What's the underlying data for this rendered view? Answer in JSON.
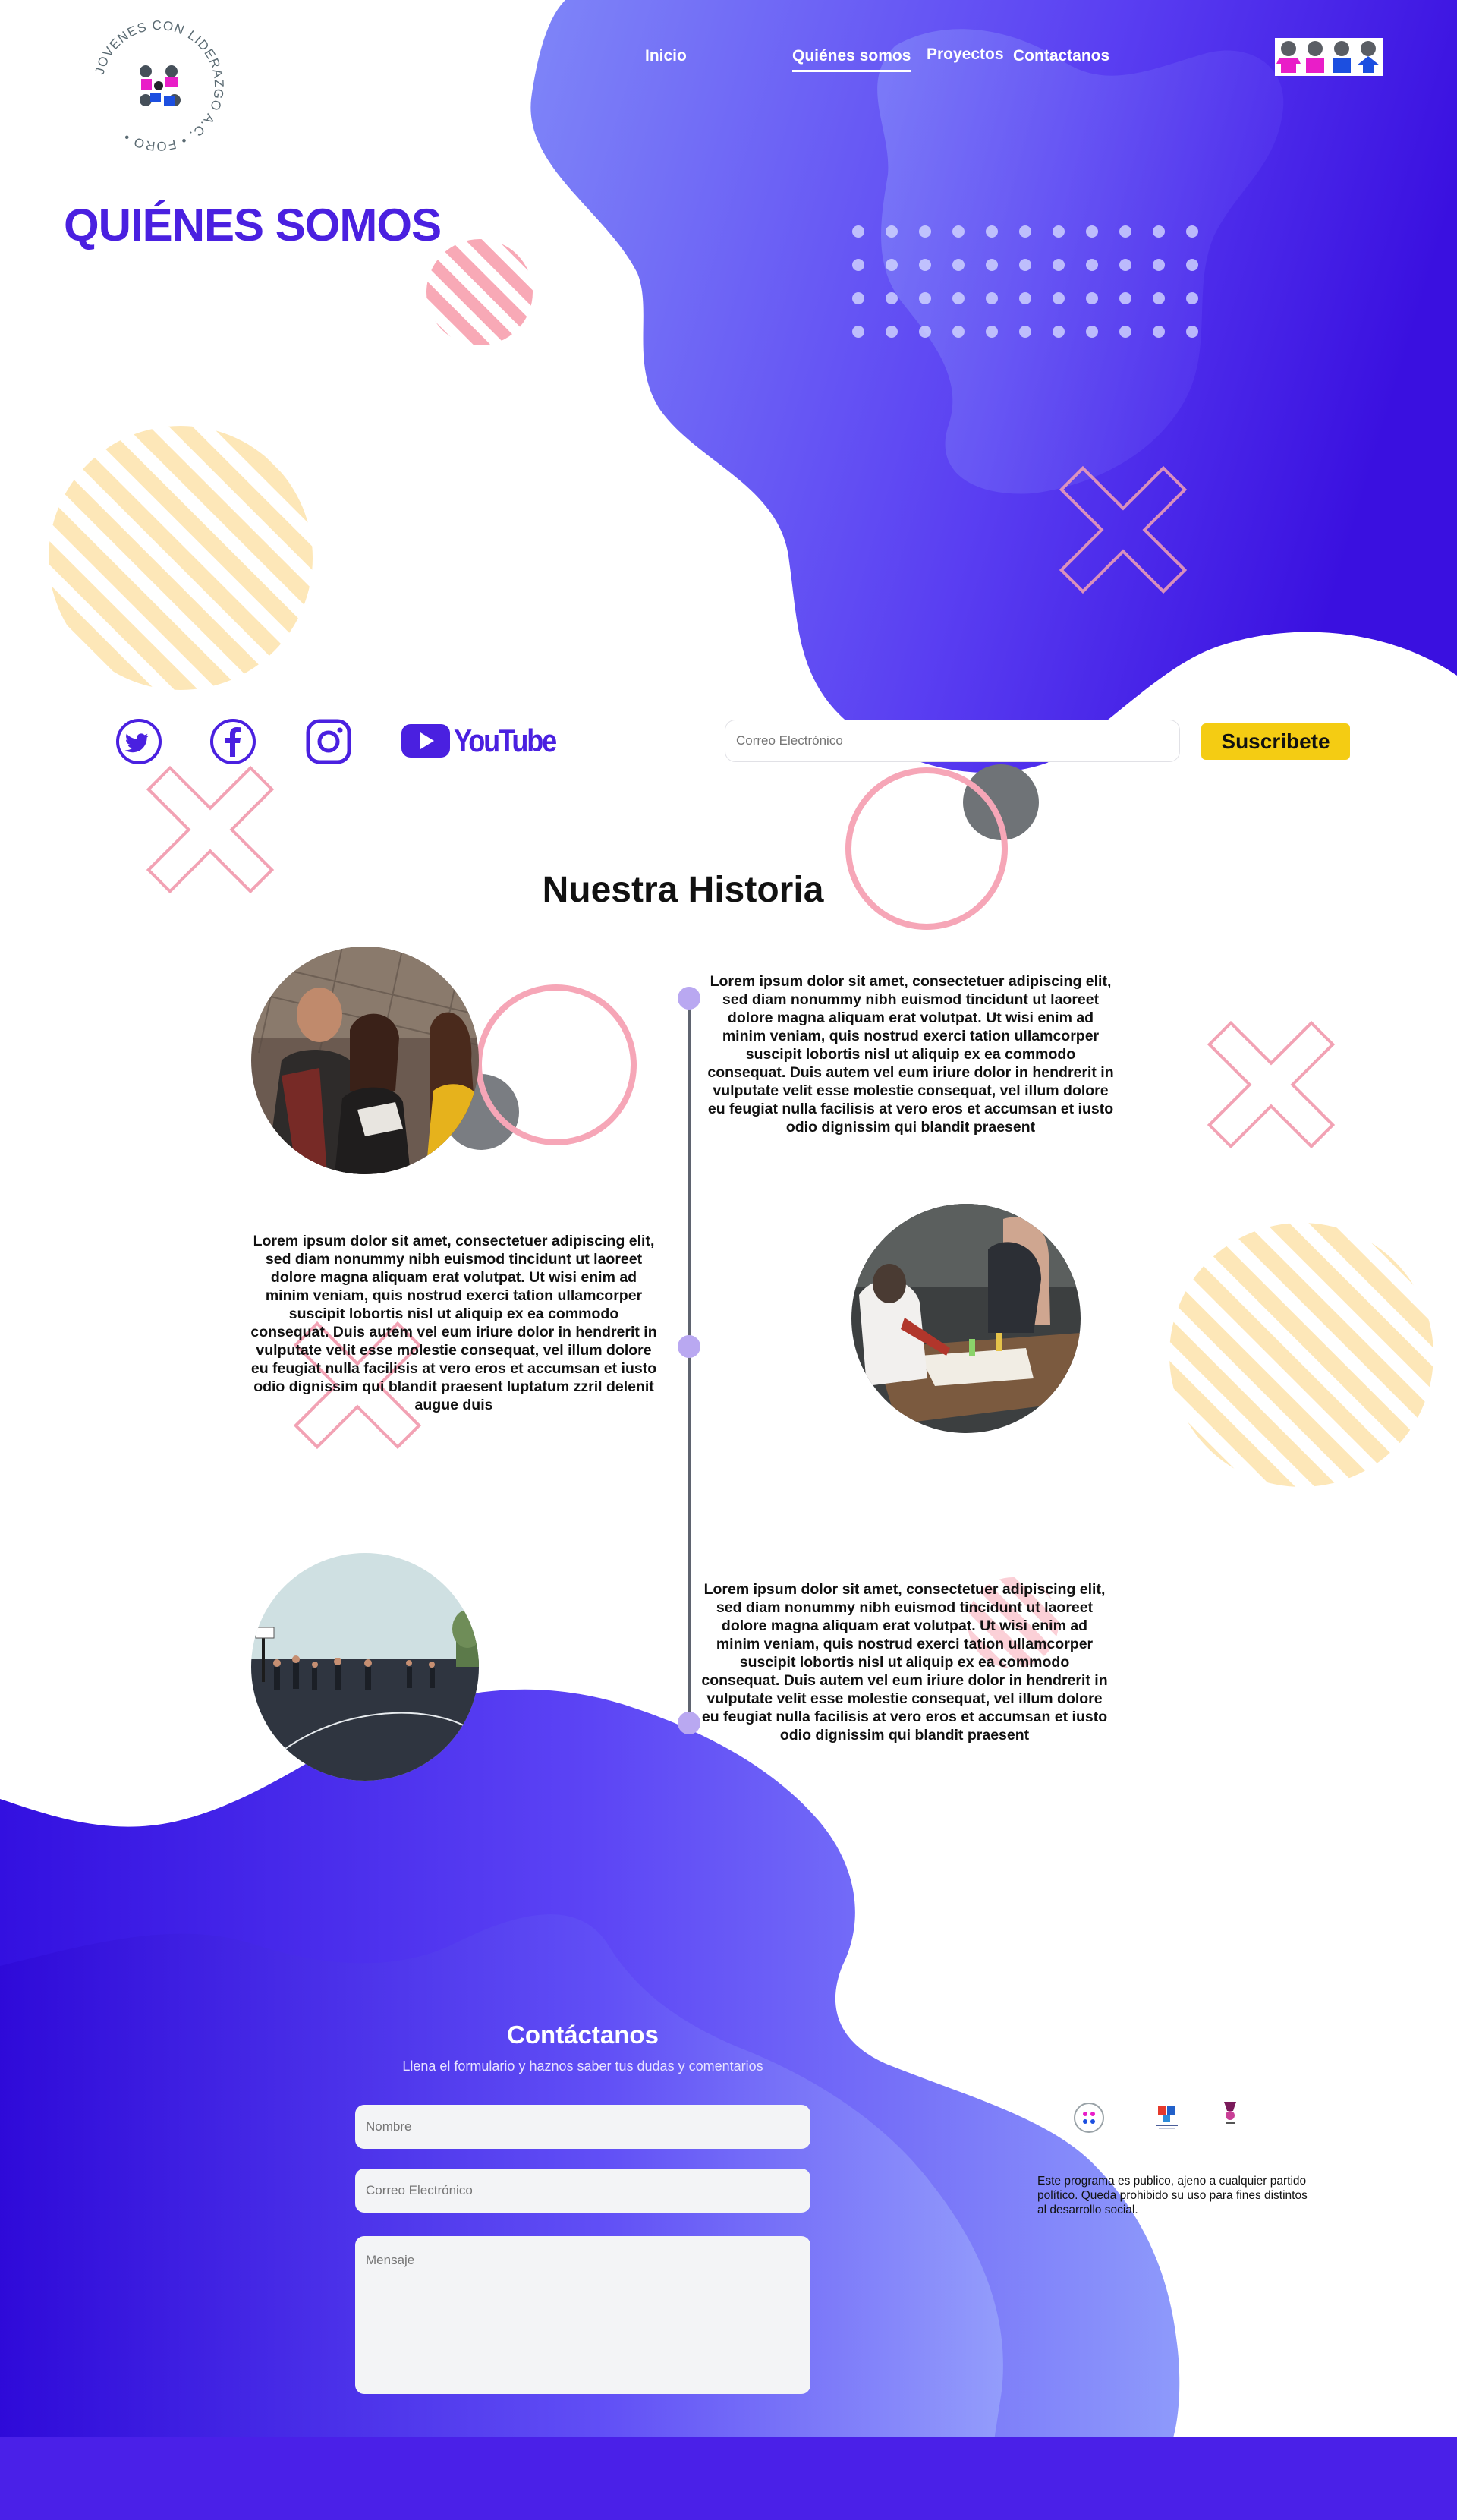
{
  "brand": {
    "logo_text": "JOVENES CON LIDERAZGO A.C. • FORO •",
    "colors": {
      "primary": "#4a20e0",
      "accent_yellow": "#f4cc13",
      "pink": "#f7a5b4",
      "stripe_yellow": "#fde7b8"
    }
  },
  "nav": {
    "items": [
      {
        "label": "Inicio"
      },
      {
        "label": "Quiénes somos",
        "active": true
      },
      {
        "label": "Proyectos"
      },
      {
        "label": "Contactanos"
      }
    ],
    "right_logo_icon": "people-group-icon"
  },
  "hero": {
    "title": "QUIÉNES SOMOS"
  },
  "social": {
    "icons": [
      "twitter-icon",
      "facebook-icon",
      "instagram-icon",
      "youtube-icon"
    ],
    "youtube_label": "YouTube"
  },
  "newsletter": {
    "placeholder": "Correo Electrónico",
    "button_label": "Suscribete"
  },
  "history": {
    "title": "Nuestra Historia",
    "entries": [
      {
        "text": "Lorem ipsum dolor sit amet, consectetuer adipiscing elit, sed diam nonummy nibh euismod tincidunt ut laoreet dolore magna aliquam erat volutpat. Ut wisi enim ad minim veniam, quis nostrud exerci tation ullamcorper suscipit lobortis nisl ut aliquip ex ea commodo consequat. Duis autem vel eum iriure dolor in hendrerit in vulputate velit esse molestie consequat, vel illum dolore eu feugiat nulla facilisis at vero eros et accumsan et iusto odio dignissim qui blandit praesent",
        "photo": "students-talking-photo"
      },
      {
        "text": "Lorem ipsum dolor sit amet, consectetuer adipiscing elit, sed diam nonummy nibh euismod tincidunt ut laoreet dolore magna aliquam erat volutpat. Ut wisi enim ad minim veniam, quis nostrud exerci tation ullamcorper suscipit lobortis nisl ut aliquip ex ea commodo consequat. Duis autem vel eum iriure dolor in hendrerit in vulputate velit esse molestie consequat, vel illum dolore eu feugiat nulla facilisis at vero eros et accumsan et iusto odio dignissim qui blandit praesent luptatum zzril delenit augue duis",
        "photo": "students-working-table-photo"
      },
      {
        "text": "Lorem ipsum dolor sit amet, consectetuer adipiscing elit, sed diam nonummy nibh euismod tincidunt ut laoreet dolore magna aliquam erat volutpat. Ut wisi enim ad minim veniam, quis nostrud exerci tation ullamcorper suscipit lobortis nisl ut aliquip ex ea commodo consequat. Duis autem vel eum iriure dolor in hendrerit in vulputate velit esse molestie consequat, vel illum dolore eu feugiat nulla facilisis at vero eros et accumsan et iusto odio dignissim qui blandit praesent",
        "photo": "basketball-court-photo"
      }
    ]
  },
  "contact": {
    "title": "Contáctanos",
    "subtitle": "Llena el formulario y haznos saber tus dudas y comentarios",
    "name_placeholder": "Nombre",
    "email_placeholder": "Correo Electrónico",
    "message_placeholder": "Mensaje"
  },
  "footer": {
    "partner_icons": [
      "foro-logo-icon",
      "institution-logo-icon",
      "government-logo-icon"
    ],
    "disclaimer": "Este programa es publico, ajeno a cualquier partido  político. Queda prohibido su uso para fines distintos al desarrollo social."
  }
}
